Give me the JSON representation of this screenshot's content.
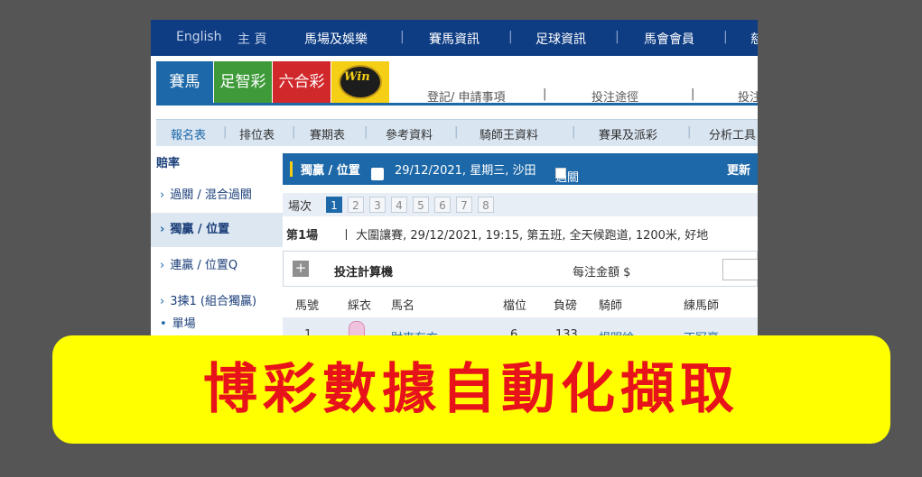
{
  "topnav": {
    "items": [
      "English",
      "主 頁",
      "馬場及娛樂",
      "|",
      "賽馬資訊",
      "|",
      "足球資訊",
      "|",
      "馬會會員",
      "|",
      "慈"
    ]
  },
  "brand": {
    "horse": "賽馬",
    "football": "足智彩",
    "mark6": "六合彩",
    "win_logo": "Win"
  },
  "links": [
    "登記/ 申請事項",
    "|",
    "投注途徑",
    "|",
    "投注"
  ],
  "submenu": [
    "報名表",
    "|",
    "排位表",
    "|",
    "賽期表",
    "|",
    "參考資料",
    "|",
    "騎師王資料",
    "|",
    "賽果及派彩",
    "|",
    "分析工具"
  ],
  "sidebar": {
    "title": "賠率",
    "items": [
      {
        "arrow": "›",
        "label": "過關 / 混合過關"
      },
      {
        "arrow": "›",
        "label": "獨贏 / 位置"
      },
      {
        "arrow": "›",
        "label": "連贏 / 位置Q"
      },
      {
        "arrow": "›",
        "label": "3揀1 (組合獨贏)"
      },
      {
        "arrow": "•",
        "label": "單場"
      }
    ]
  },
  "main": {
    "header": {
      "title": "獨贏 / 位置",
      "help": "?",
      "date": "29/12/2021, 星期三, 沙田",
      "parlay": "過關",
      "update": "更新"
    },
    "race_label": "場次",
    "races": [
      "1",
      "2",
      "3",
      "4",
      "5",
      "6",
      "7",
      "8"
    ],
    "race_title": "第1場",
    "race_detail": "丨 大圍讓賽, 29/12/2021, 19:15, 第五班, 全天候跑道, 1200米, 好地",
    "calc": {
      "plus": "+",
      "title": "投注計算機",
      "amount_label": "每注金額 $"
    },
    "table_headers": [
      "馬號",
      "綵衣",
      "馬名",
      "檔位",
      "負磅",
      "騎師",
      "練馬師"
    ],
    "row": [
      "1",
      "財來有方",
      "6",
      "133",
      "楊明綸",
      "丁冠豪"
    ]
  },
  "banner": {
    "text": "博彩數據自動化擷取"
  },
  "colors": {
    "nav": "#0f3d84",
    "horse": "#1d68a8",
    "football": "#3f9b3a",
    "mark6": "#d1282c",
    "win": "#f4cf15",
    "banner_bg": "#ffff00",
    "banner_text": "#e8121a"
  }
}
